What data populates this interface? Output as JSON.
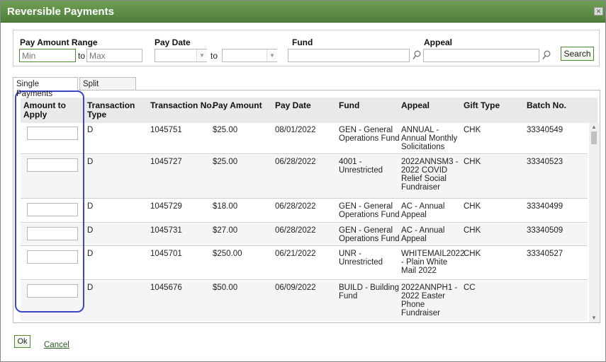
{
  "dialog": {
    "title": "Reversible Payments",
    "close_label": "✕"
  },
  "filters": {
    "pay_amount_range_label": "Pay Amount Range",
    "min_placeholder": "Min",
    "to_label": "to",
    "max_placeholder": "Max",
    "pay_date_label": "Pay Date",
    "pay_date_to_label": "to",
    "fund_label": "Fund",
    "appeal_label": "Appeal",
    "search_label": "Search"
  },
  "tabs": [
    {
      "label": "Single Payments",
      "active": true
    },
    {
      "label": "Split Payments",
      "active": false
    }
  ],
  "table": {
    "headers": [
      "Amount to Apply",
      "Transaction Type",
      "Transaction No.",
      "Pay Amount",
      "Pay Date",
      "Fund",
      "Appeal",
      "Gift Type",
      "Batch No."
    ],
    "header_lines": {
      "amount": [
        "Amount to",
        "Apply"
      ],
      "type": [
        "Transaction",
        "Type"
      ]
    },
    "rows": [
      {
        "type": "D",
        "txn": "1045751",
        "amount": "$25.00",
        "date": "08/01/2022",
        "fund": [
          "GEN - General",
          "Operations Fund"
        ],
        "appeal": [
          "ANNUAL -",
          "Annual Monthly",
          "Solicitations"
        ],
        "gift": "CHK",
        "batch": "33340549"
      },
      {
        "type": "D",
        "txn": "1045727",
        "amount": "$25.00",
        "date": "06/28/2022",
        "fund": [
          "4001 -",
          "Unrestricted"
        ],
        "appeal": [
          "2022ANNSM3 -",
          "2022 COVID",
          "Relief Social",
          "Fundraiser"
        ],
        "gift": "CHK",
        "batch": "33340523"
      },
      {
        "type": "D",
        "txn": "1045729",
        "amount": "$18.00",
        "date": "06/28/2022",
        "fund": [
          "GEN - General",
          "Operations Fund"
        ],
        "appeal": [
          "AC - Annual",
          "Appeal"
        ],
        "gift": "CHK",
        "batch": "33340499"
      },
      {
        "type": "D",
        "txn": "1045731",
        "amount": "$27.00",
        "date": "06/28/2022",
        "fund": [
          "GEN - General",
          "Operations Fund"
        ],
        "appeal": [
          "AC - Annual",
          "Appeal"
        ],
        "gift": "CHK",
        "batch": "33340509"
      },
      {
        "type": "D",
        "txn": "1045701",
        "amount": "$250.00",
        "date": "06/21/2022",
        "fund": [
          "UNR -",
          "Unrestricted"
        ],
        "appeal": [
          "WHITEMAIL2022",
          "- Plain White",
          "Mail 2022"
        ],
        "gift": "CHK",
        "batch": "33340527"
      },
      {
        "type": "D",
        "txn": "1045676",
        "amount": "$50.00",
        "date": "06/09/2022",
        "fund": [
          "BUILD - Building",
          "Fund"
        ],
        "appeal": [
          "2022ANNPH1 -",
          "2022 Easter",
          "Phone",
          "Fundraiser"
        ],
        "gift": "CC",
        "batch": ""
      }
    ]
  },
  "footer": {
    "ok_label": "Ok",
    "cancel_label": "Cancel"
  },
  "colors": {
    "titlebar": "#5a8a42",
    "highlight": "#3d45c9",
    "accent": "#4e8a2f"
  },
  "icons": {
    "field_search": "magnifier-icon",
    "close": "close-icon"
  }
}
